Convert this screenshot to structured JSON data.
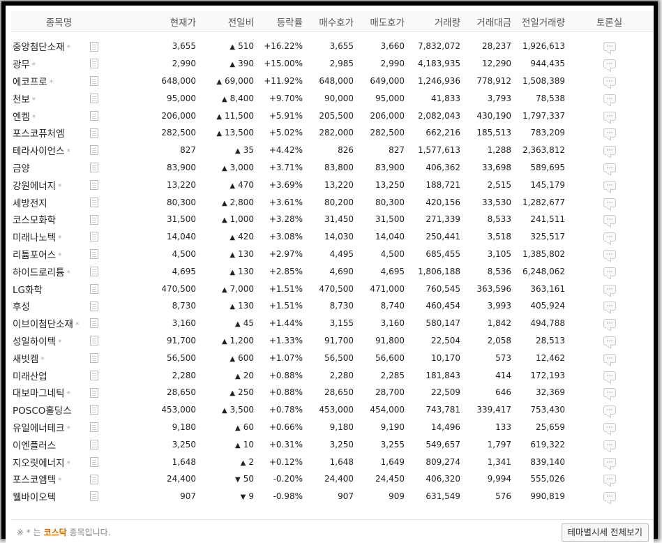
{
  "columns": {
    "name": "종목명",
    "price": "현재가",
    "change": "전일비",
    "rate": "등락률",
    "bid": "매수호가",
    "ask": "매도호가",
    "volume": "거래량",
    "amount": "거래대금",
    "prev_volume": "전일거래량",
    "talk": "토론실"
  },
  "rows": [
    {
      "name": "중앙첨단소재",
      "star": "*",
      "price": "3,655",
      "dir": "up",
      "arrow": "▲",
      "change": "510",
      "rate": "+16.22%",
      "bid": "3,655",
      "ask": "3,660",
      "volume": "7,832,072",
      "amount": "28,237",
      "prev_volume": "1,926,613"
    },
    {
      "name": "광무",
      "star": "*",
      "price": "2,990",
      "dir": "up",
      "arrow": "▲",
      "change": "390",
      "rate": "+15.00%",
      "bid": "2,985",
      "ask": "2,990",
      "volume": "4,183,935",
      "amount": "12,290",
      "prev_volume": "944,435"
    },
    {
      "name": "에코프로",
      "star": "*",
      "price": "648,000",
      "dir": "up",
      "arrow": "▲",
      "change": "69,000",
      "rate": "+11.92%",
      "bid": "648,000",
      "ask": "649,000",
      "volume": "1,246,936",
      "amount": "778,912",
      "prev_volume": "1,508,389"
    },
    {
      "name": "천보",
      "star": "*",
      "price": "95,000",
      "dir": "up",
      "arrow": "▲",
      "change": "8,400",
      "rate": "+9.70%",
      "bid": "90,000",
      "ask": "95,000",
      "volume": "41,833",
      "amount": "3,793",
      "prev_volume": "78,538"
    },
    {
      "name": "엔켐",
      "star": "*",
      "price": "206,000",
      "dir": "up",
      "arrow": "▲",
      "change": "11,500",
      "rate": "+5.91%",
      "bid": "205,500",
      "ask": "206,000",
      "volume": "2,082,043",
      "amount": "430,190",
      "prev_volume": "1,797,337"
    },
    {
      "name": "포스코퓨처엠",
      "star": "",
      "price": "282,500",
      "dir": "up",
      "arrow": "▲",
      "change": "13,500",
      "rate": "+5.02%",
      "bid": "282,000",
      "ask": "282,500",
      "volume": "662,216",
      "amount": "185,513",
      "prev_volume": "783,209"
    },
    {
      "name": "테라사이언스",
      "star": "*",
      "price": "827",
      "dir": "up",
      "arrow": "▲",
      "change": "35",
      "rate": "+4.42%",
      "bid": "826",
      "ask": "827",
      "volume": "1,577,613",
      "amount": "1,288",
      "prev_volume": "2,363,812"
    },
    {
      "name": "금양",
      "star": "",
      "price": "83,900",
      "dir": "up",
      "arrow": "▲",
      "change": "3,000",
      "rate": "+3.71%",
      "bid": "83,800",
      "ask": "83,900",
      "volume": "406,362",
      "amount": "33,698",
      "prev_volume": "589,695"
    },
    {
      "name": "강원에너지",
      "star": "*",
      "price": "13,220",
      "dir": "up",
      "arrow": "▲",
      "change": "470",
      "rate": "+3.69%",
      "bid": "13,220",
      "ask": "13,250",
      "volume": "188,721",
      "amount": "2,515",
      "prev_volume": "145,179"
    },
    {
      "name": "세방전지",
      "star": "",
      "price": "80,300",
      "dir": "up",
      "arrow": "▲",
      "change": "2,800",
      "rate": "+3.61%",
      "bid": "80,200",
      "ask": "80,300",
      "volume": "420,156",
      "amount": "33,530",
      "prev_volume": "1,282,677"
    },
    {
      "name": "코스모화학",
      "star": "",
      "price": "31,500",
      "dir": "up",
      "arrow": "▲",
      "change": "1,000",
      "rate": "+3.28%",
      "bid": "31,450",
      "ask": "31,500",
      "volume": "271,339",
      "amount": "8,533",
      "prev_volume": "241,511"
    },
    {
      "name": "미래나노텍",
      "star": "*",
      "price": "14,040",
      "dir": "up",
      "arrow": "▲",
      "change": "420",
      "rate": "+3.08%",
      "bid": "14,030",
      "ask": "14,040",
      "volume": "250,441",
      "amount": "3,518",
      "prev_volume": "325,517"
    },
    {
      "name": "리튬포어스",
      "star": "*",
      "price": "4,500",
      "dir": "up",
      "arrow": "▲",
      "change": "130",
      "rate": "+2.97%",
      "bid": "4,495",
      "ask": "4,500",
      "volume": "685,455",
      "amount": "3,105",
      "prev_volume": "1,385,802"
    },
    {
      "name": "하이드로리튬",
      "star": "*",
      "price": "4,695",
      "dir": "up",
      "arrow": "▲",
      "change": "130",
      "rate": "+2.85%",
      "bid": "4,690",
      "ask": "4,695",
      "volume": "1,806,188",
      "amount": "8,536",
      "prev_volume": "6,248,062"
    },
    {
      "name": "LG화학",
      "star": "",
      "price": "470,500",
      "dir": "up",
      "arrow": "▲",
      "change": "7,000",
      "rate": "+1.51%",
      "bid": "470,500",
      "ask": "471,000",
      "volume": "760,545",
      "amount": "363,596",
      "prev_volume": "363,161"
    },
    {
      "name": "후성",
      "star": "",
      "price": "8,730",
      "dir": "up",
      "arrow": "▲",
      "change": "130",
      "rate": "+1.51%",
      "bid": "8,730",
      "ask": "8,740",
      "volume": "460,454",
      "amount": "3,993",
      "prev_volume": "405,924"
    },
    {
      "name": "이브이첨단소재",
      "star": "*",
      "price": "3,160",
      "dir": "up",
      "arrow": "▲",
      "change": "45",
      "rate": "+1.44%",
      "bid": "3,155",
      "ask": "3,160",
      "volume": "580,147",
      "amount": "1,842",
      "prev_volume": "494,788"
    },
    {
      "name": "성일하이텍",
      "star": "*",
      "price": "91,700",
      "dir": "up",
      "arrow": "▲",
      "change": "1,200",
      "rate": "+1.33%",
      "bid": "91,700",
      "ask": "91,800",
      "volume": "22,504",
      "amount": "2,058",
      "prev_volume": "28,513"
    },
    {
      "name": "새빗켐",
      "star": "*",
      "price": "56,500",
      "dir": "up",
      "arrow": "▲",
      "change": "600",
      "rate": "+1.07%",
      "bid": "56,500",
      "ask": "56,600",
      "volume": "10,170",
      "amount": "573",
      "prev_volume": "12,462"
    },
    {
      "name": "미래산업",
      "star": "",
      "price": "2,280",
      "dir": "up",
      "arrow": "▲",
      "change": "20",
      "rate": "+0.88%",
      "bid": "2,280",
      "ask": "2,285",
      "volume": "181,843",
      "amount": "414",
      "prev_volume": "172,193"
    },
    {
      "name": "대보마그네틱",
      "star": "*",
      "price": "28,650",
      "dir": "up",
      "arrow": "▲",
      "change": "250",
      "rate": "+0.88%",
      "bid": "28,650",
      "ask": "28,700",
      "volume": "22,509",
      "amount": "646",
      "prev_volume": "32,369"
    },
    {
      "name": "POSCO홀딩스",
      "star": "",
      "price": "453,000",
      "dir": "up",
      "arrow": "▲",
      "change": "3,500",
      "rate": "+0.78%",
      "bid": "453,000",
      "ask": "454,000",
      "volume": "743,781",
      "amount": "339,417",
      "prev_volume": "753,430"
    },
    {
      "name": "유일에너테크",
      "star": "*",
      "price": "9,180",
      "dir": "up",
      "arrow": "▲",
      "change": "60",
      "rate": "+0.66%",
      "bid": "9,180",
      "ask": "9,190",
      "volume": "14,496",
      "amount": "133",
      "prev_volume": "25,659"
    },
    {
      "name": "이엔플러스",
      "star": "",
      "price": "3,250",
      "dir": "up",
      "arrow": "▲",
      "change": "10",
      "rate": "+0.31%",
      "bid": "3,250",
      "ask": "3,255",
      "volume": "549,657",
      "amount": "1,797",
      "prev_volume": "619,322"
    },
    {
      "name": "지오릿에너지",
      "star": "*",
      "price": "1,648",
      "dir": "up",
      "arrow": "▲",
      "change": "2",
      "rate": "+0.12%",
      "bid": "1,648",
      "ask": "1,649",
      "volume": "809,274",
      "amount": "1,341",
      "prev_volume": "839,140"
    },
    {
      "name": "포스코엠텍",
      "star": "*",
      "price": "24,400",
      "dir": "down",
      "arrow": "▼",
      "change": "50",
      "rate": "-0.20%",
      "bid": "24,400",
      "ask": "24,450",
      "volume": "406,320",
      "amount": "9,994",
      "prev_volume": "555,026"
    },
    {
      "name": "웰바이오텍",
      "star": "",
      "price": "907",
      "dir": "down",
      "arrow": "▼",
      "change": "9",
      "rate": "-0.98%",
      "bid": "907",
      "ask": "909",
      "volume": "631,549",
      "amount": "576",
      "prev_volume": "990,819"
    }
  ],
  "footer": {
    "note_prefix": "※ * 는 ",
    "note_highlight": "코스닥",
    "note_suffix": " 종목입니다.",
    "button_label": "테마별시세 전체보기"
  },
  "icons": {
    "document": "document-icon",
    "discussion": "speech-bubble-icon"
  },
  "colors": {
    "up": "#d60000",
    "down": "#1a63c6",
    "kosdaq_highlight": "#e26a00"
  }
}
